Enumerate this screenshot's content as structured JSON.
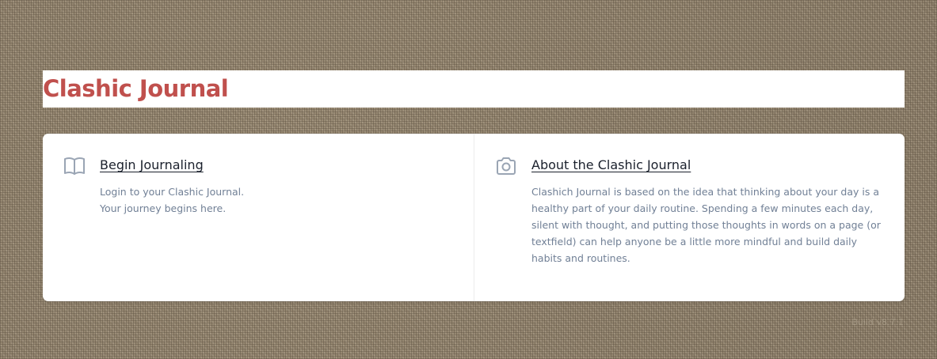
{
  "header": {
    "title": "Clashic Journal"
  },
  "panels": [
    {
      "icon": "book-open-icon",
      "title": "Begin Journaling",
      "lines": [
        "Login to your Clashic Journal.",
        "Your journey begins here."
      ]
    },
    {
      "icon": "camera-icon",
      "title": "About the Clashic Journal",
      "text": "Clashich Journal is based on the idea that thinking about your day is a healthy part of your daily routine. Spending a few minutes each day, silent with thought, and putting those thoughts in words on a page (or textfield) can help anyone be a little more mindful and build daily habits and routines."
    }
  ],
  "footer": {
    "text": "Build v8.7.1"
  },
  "colors": {
    "title_accent": "#c0504d",
    "heading_text": "#1a202c",
    "muted_text": "#718096",
    "icon_stroke": "#9aa5b4"
  }
}
